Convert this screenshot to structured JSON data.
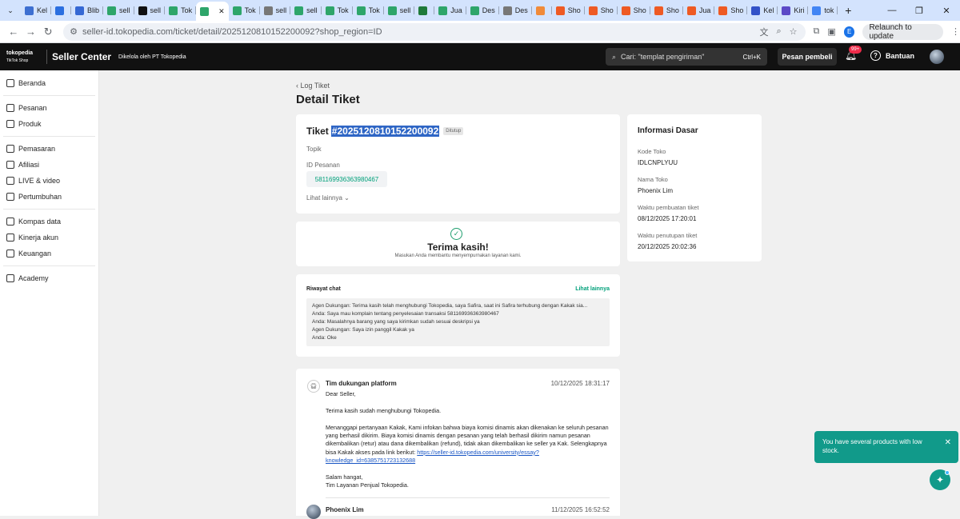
{
  "browser": {
    "tabs": [
      {
        "label": "Kel",
        "color": "#3d6fd1"
      },
      {
        "label": "",
        "color": "#2b6fe0"
      },
      {
        "label": "Blib",
        "color": "#3568d4"
      },
      {
        "label": "sell",
        "color": "#2ea56a"
      },
      {
        "label": "sell",
        "color": "#111111"
      },
      {
        "label": "Tok",
        "color": "#2ea56a"
      },
      {
        "label": "",
        "color": "#2ea56a"
      },
      {
        "label": "Tok",
        "color": "#2ea56a"
      },
      {
        "label": "sell",
        "color": "#777777"
      },
      {
        "label": "sell",
        "color": "#2ea56a"
      },
      {
        "label": "Tok",
        "color": "#2ea56a"
      },
      {
        "label": "Tok",
        "color": "#2ea56a"
      },
      {
        "label": "sell",
        "color": "#2ea56a"
      },
      {
        "label": "",
        "color": "#1f7a3a"
      },
      {
        "label": "Jua",
        "color": "#2ea56a"
      },
      {
        "label": "Des",
        "color": "#2ea56a"
      },
      {
        "label": "Des",
        "color": "#777777"
      },
      {
        "label": "",
        "color": "#f08a3a"
      },
      {
        "label": "Sho",
        "color": "#ee5a24"
      },
      {
        "label": "Sho",
        "color": "#ee5a24"
      },
      {
        "label": "Sho",
        "color": "#ee5a24"
      },
      {
        "label": "Sho",
        "color": "#ee5a24"
      },
      {
        "label": "Jua",
        "color": "#ee5a24"
      },
      {
        "label": "Sho",
        "color": "#ee5a24"
      },
      {
        "label": "Kel",
        "color": "#3352c8"
      },
      {
        "label": "Kiri",
        "color": "#5b49c7"
      },
      {
        "label": "tok",
        "color": "#4285f4"
      }
    ],
    "active_tab_index": 6,
    "new_tab": "+",
    "url": "seller-id.tokopedia.com/ticket/detail/2025120810152200092?shop_region=ID",
    "profile_letter": "E",
    "relaunch": "Relaunch to update"
  },
  "header": {
    "logo_top": "tokopedia",
    "logo_bottom": "TikTok Shop",
    "title": "Seller Center",
    "subtitle": "Dikelola oleh PT Tokopedia",
    "search_placeholder": "Cari: \"templat pengiriman\"",
    "search_shortcut": "Ctrl+K",
    "buyer_msg": "Pesan pembeli",
    "notif_badge": "99+",
    "help": "Bantuan"
  },
  "sidebar": {
    "groups": [
      [
        "Beranda"
      ],
      [
        "Pesanan",
        "Produk"
      ],
      [
        "Pemasaran",
        "Afiliasi",
        "LIVE & video",
        "Pertumbuhan"
      ],
      [
        "Kompas data",
        "Kinerja akun",
        "Keuangan"
      ],
      [
        "Academy"
      ]
    ]
  },
  "page": {
    "breadcrumb": "‹ Log Tiket",
    "title": "Detail Tiket"
  },
  "ticket": {
    "prefix": "Tiket",
    "id": "#2025120810152200092",
    "status": "Ditutup",
    "topic_label": "Topik",
    "order_label": "ID Pesanan",
    "order_id": "581169936363980467",
    "see_more": "Lihat lainnya ⌄"
  },
  "thanks": {
    "title": "Terima kasih!",
    "subtitle": "Masukan Anda membantu menyempurnakan layanan kami."
  },
  "chat": {
    "title": "Riwayat chat",
    "see_more": "Lihat lainnya",
    "lines": [
      "Agen Dukungan: Terima kasih telah menghubungi Tokopedia, saya Safira, saat ini Safira terhubung dengan Kakak sia...",
      "Anda: Saya mau komplain tentang penyelesaian transaksi 581169936363980467",
      "Anda: Masalahnya barang yang saya kirimkan sudah sesuai deskripsi ya",
      "Agen Dukungan: Saya izin panggil Kakak ya",
      "Anda: Oke"
    ]
  },
  "messages": {
    "first": {
      "author": "Tim dukungan platform",
      "time": "10/12/2025 18:31:17",
      "greeting": "Dear Seller,",
      "para1": "Terima kasih sudah menghubungi Tokopedia.",
      "para2": "Menanggapi pertanyaan Kakak, Kami infokan bahwa biaya komisi dinamis akan dikenakan ke seluruh pesanan yang berhasil dikirim. Biaya komisi dinamis dengan pesanan yang telah berhasil dikirim namun pesanan dikembalikan (retur) atau dana dikembalikan (refund), tidak akan dikembalikan ke seller ya Kak. Selengkapnya bisa Kakak akses pada link berikut:",
      "link": "https://seller-id.tokopedia.com/university/essay?knowledge_id=6385751723132688",
      "closing1": "Salam hangat,",
      "closing2": "Tim Layanan Penjual Tokopedia."
    },
    "second": {
      "author": "Phoenix Lim",
      "time": "11/12/2025 16:52:52"
    }
  },
  "info": {
    "title": "Informasi Dasar",
    "shop_code_label": "Kode Toko",
    "shop_code": "IDLCNPLYUU",
    "shop_name_label": "Nama Toko",
    "shop_name": "Phoenix Lim",
    "created_label": "Waktu pembuatan tiket",
    "created": "08/12/2025 17:20:01",
    "closed_label": "Waktu penutupan tiket",
    "closed": "20/12/2025 20:02:36"
  },
  "toast": {
    "text": "You have several products with low stock."
  }
}
